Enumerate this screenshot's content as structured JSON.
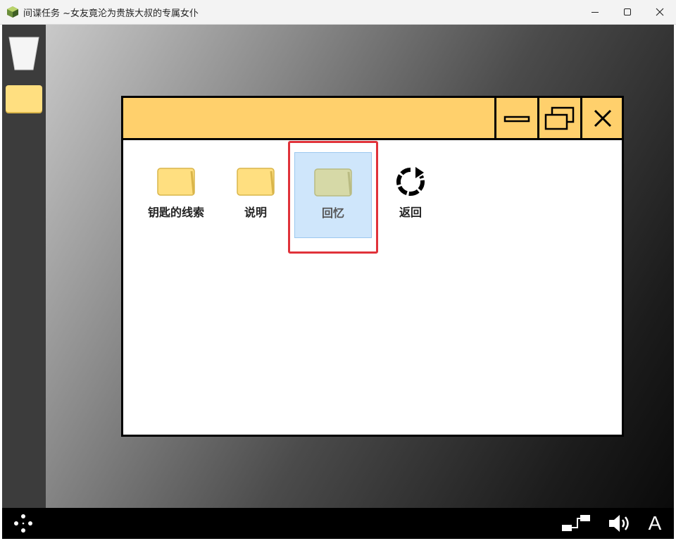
{
  "window": {
    "title": "间谍任务 ~女友竟沦为贵族大叔的专属女仆",
    "icon": "app-cube-icon",
    "controls": [
      "minimize-icon",
      "maximize-icon",
      "close-icon"
    ]
  },
  "sidebar": {
    "icons": [
      "trash-icon",
      "folder-icon"
    ]
  },
  "explorer": {
    "title_buttons": [
      "minimize-icon",
      "restore-icon",
      "close-icon"
    ],
    "items": [
      {
        "label": "钥匙的线索",
        "icon": "folder-icon"
      },
      {
        "label": "说明",
        "icon": "folder-icon"
      },
      {
        "label": "回忆",
        "icon": "folder-icon",
        "selected": true
      },
      {
        "label": "返回",
        "icon": "refresh-icon"
      }
    ]
  },
  "taskbar": {
    "icons": [
      "gamepad-dots-icon",
      "network-icon",
      "speaker-icon",
      "text-size-icon"
    ],
    "text_size_label": "A"
  },
  "colors": {
    "window_title_bg": "#ffd06c",
    "folder": "#ffdf80",
    "selection_bg": "#cfe6fb",
    "highlight_border": "#e0323a"
  }
}
